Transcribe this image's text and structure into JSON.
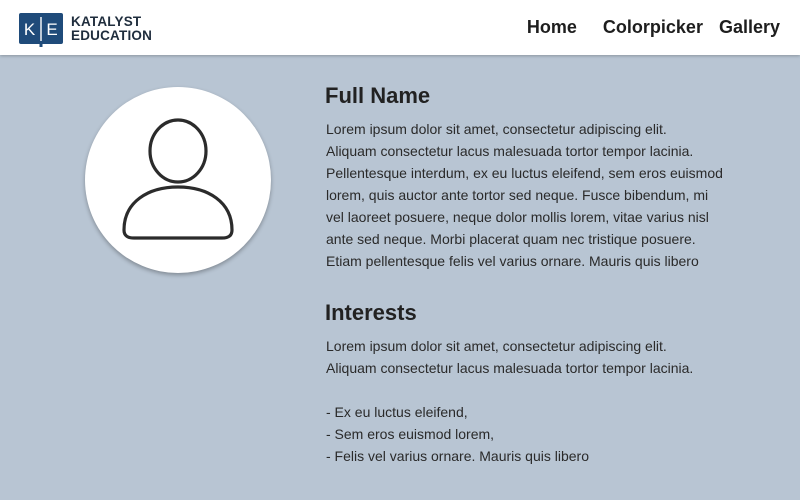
{
  "brand": {
    "mark_letters": [
      "K",
      "E"
    ],
    "line1": "KATALYST",
    "line2": "EDUCATION",
    "color": "#1f4b7a"
  },
  "nav": {
    "items": [
      {
        "label": "Home"
      },
      {
        "label": "Colorpicker"
      },
      {
        "label": "Gallery"
      }
    ]
  },
  "profile": {
    "avatar_icon": "user-icon",
    "name_heading": "Full Name",
    "bio": "Lorem ipsum dolor sit amet, consectetur adipiscing elit.\nAliquam consectetur lacus malesuada tortor tempor lacinia.\nPellentesque interdum, ex eu luctus eleifend, sem eros euismod\nlorem, quis auctor ante tortor sed neque. Fusce bibendum, mi\nvel laoreet posuere, neque dolor mollis lorem, vitae varius nisl\nante sed neque. Morbi placerat quam nec tristique posuere.\nEtiam pellentesque felis vel varius ornare. Mauris quis libero",
    "interests_heading": "Interests",
    "interests_intro": "Lorem ipsum dolor sit amet, consectetur adipiscing elit.\nAliquam consectetur lacus malesuada tortor tempor lacinia.",
    "interests_list": [
      "- Ex eu luctus eleifend,",
      "- Sem eros euismod lorem,",
      "- Felis vel varius ornare. Mauris quis libero"
    ]
  },
  "colors": {
    "background": "#b8c5d3",
    "header": "#ffffff"
  }
}
